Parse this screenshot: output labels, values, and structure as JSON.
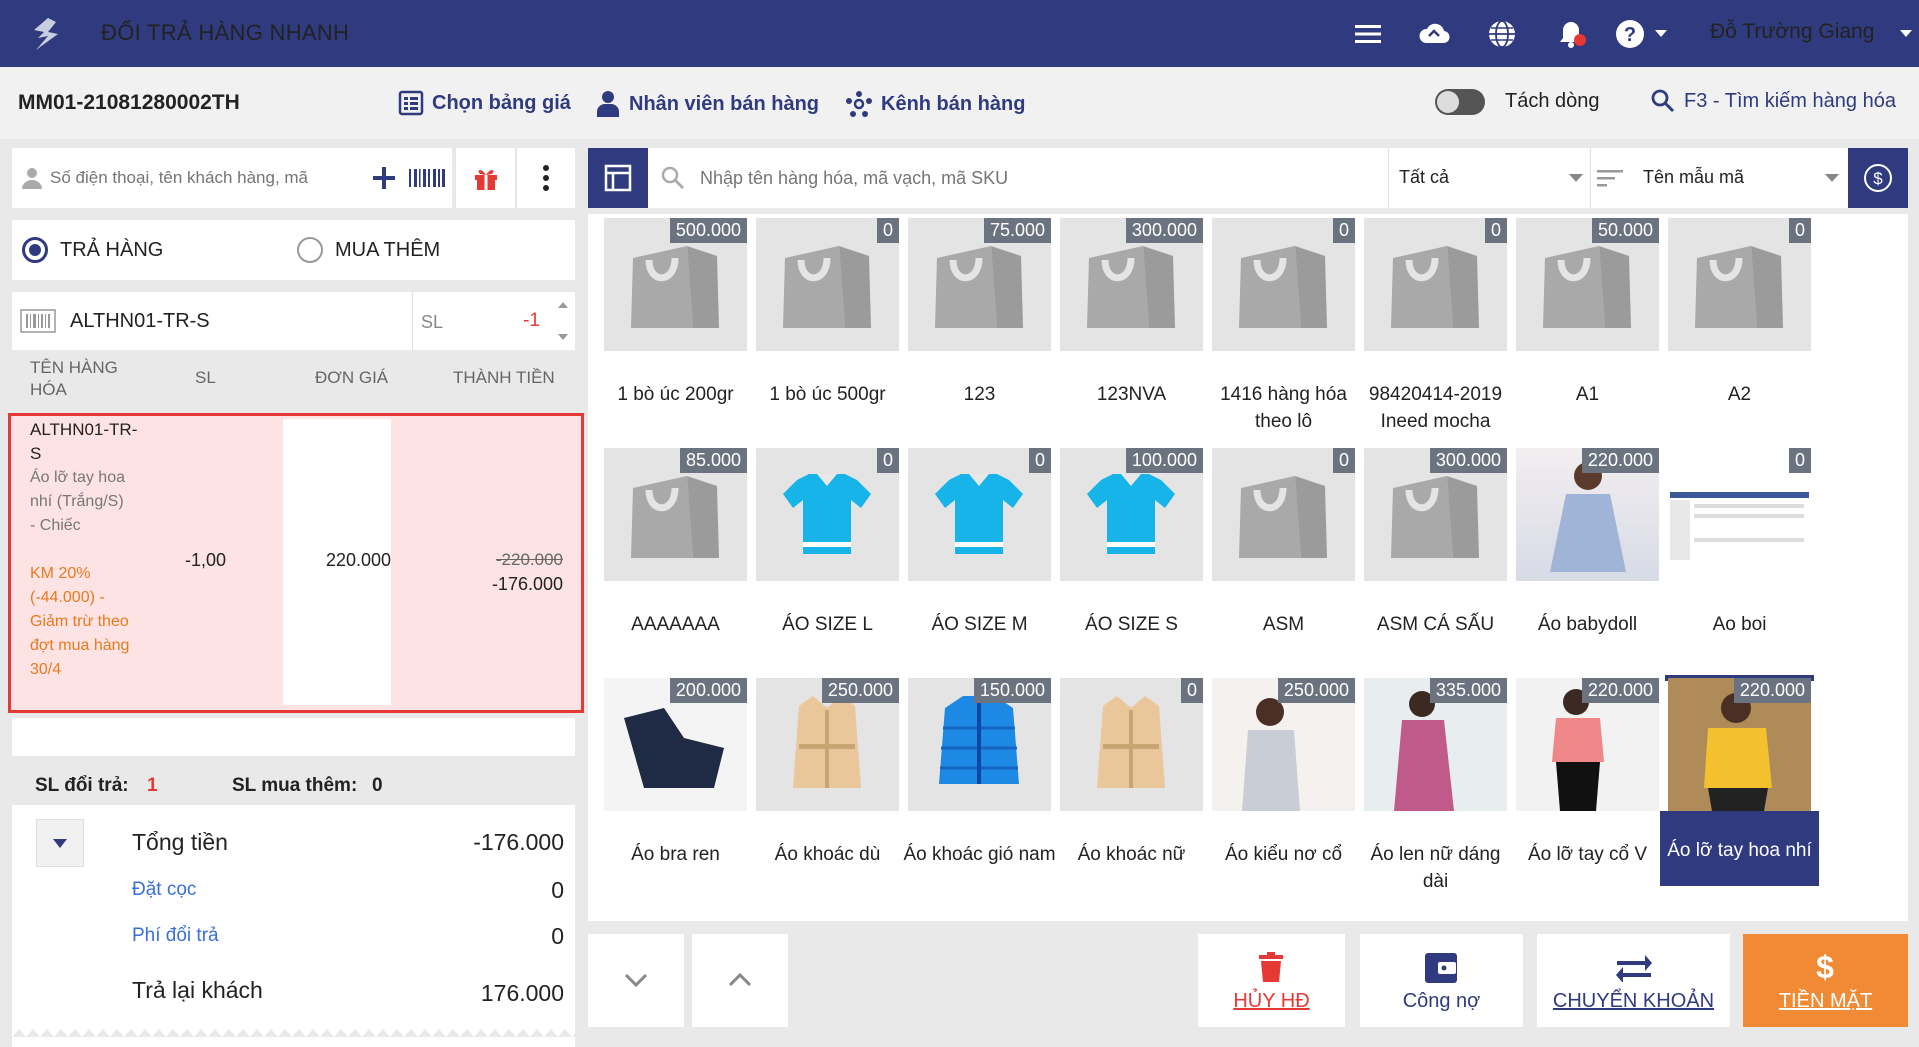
{
  "header": {
    "app_title": "ĐỔI TRẢ HÀNG NHANH",
    "user_name": "Đỗ Trường Giang",
    "icons": [
      "menu-icon",
      "cloud-sync-icon",
      "globe-icon",
      "bell-icon",
      "help-icon"
    ]
  },
  "toolbar": {
    "order_code": "MM01-21081280002TH",
    "price_list": "Chọn bảng giá",
    "sales_staff": "Nhân viên bán hàng",
    "sales_channel": "Kênh bán hàng",
    "split_line": "Tách dòng",
    "search_goods": "F3 - Tìm kiếm hàng hóa"
  },
  "customer": {
    "placeholder": "Số điện thoại, tên khách hàng, mã"
  },
  "mode": {
    "return_label": "TRẢ HÀNG",
    "buy_more_label": "MUA THÊM"
  },
  "scan": {
    "code": "ALTHN01-TR-S",
    "qty_label": "SL",
    "qty_value": "-1"
  },
  "table": {
    "col_name": "TÊN HÀNG HÓA",
    "col_qty": "SL",
    "col_price": "ĐƠN GIÁ",
    "col_total": "THÀNH TIỀN"
  },
  "item": {
    "code": "ALTHN01-TR-S",
    "desc": "Áo lỡ tay hoa nhí (Trắng/S) - Chiếc",
    "promo": "KM 20% (-44.000) - Giảm trừ theo đợt mua hàng 30/4",
    "qty": "-1,00",
    "unit_price": "220.000",
    "old_total": "-220.000",
    "total": "-176.000"
  },
  "summary": {
    "return_qty_label": "SL đổi trả:",
    "return_qty": "1",
    "buy_more_label": "SL mua thêm:",
    "buy_more": "0"
  },
  "totals": {
    "total_label": "Tổng tiền",
    "total_value": "-176.000",
    "deposit_label": "Đặt cọc",
    "deposit_value": "0",
    "fee_label": "Phí đổi trả",
    "fee_value": "0",
    "refund_label": "Trả lại khách",
    "refund_value": "176.000"
  },
  "search": {
    "placeholder": "Nhập tên hàng hóa, mã vạch, mã SKU",
    "filter_all": "Tất cả",
    "sort_label": "Tên mẫu mã"
  },
  "products": [
    {
      "name": "1 bò úc 200gr",
      "price": "500.000",
      "img": "bag"
    },
    {
      "name": "1 bò úc 500gr",
      "price": "0",
      "img": "bag"
    },
    {
      "name": "123",
      "price": "75.000",
      "img": "bag"
    },
    {
      "name": "123NVA",
      "price": "300.000",
      "img": "bag"
    },
    {
      "name": "1416 hàng hóa theo lô",
      "price": "0",
      "img": "bag"
    },
    {
      "name": "98420414-2019 Ineed mocha",
      "price": "0",
      "img": "bag"
    },
    {
      "name": "A1",
      "price": "50.000",
      "img": "bag"
    },
    {
      "name": "A2",
      "price": "0",
      "img": "bag"
    },
    {
      "name": "AAAAAAA",
      "price": "85.000",
      "img": "bag"
    },
    {
      "name": "ÁO SIZE L",
      "price": "0",
      "img": "shirt"
    },
    {
      "name": "ÁO SIZE M",
      "price": "0",
      "img": "shirt"
    },
    {
      "name": "ÁO SIZE S",
      "price": "100.000",
      "img": "shirt"
    },
    {
      "name": "ASM",
      "price": "0",
      "img": "bag"
    },
    {
      "name": "ASM CÁ SẤU",
      "price": "300.000",
      "img": "bag"
    },
    {
      "name": "Áo babydoll",
      "price": "220.000",
      "img": "photo-blue"
    },
    {
      "name": "Ao boi",
      "price": "0",
      "img": "photo-screen"
    },
    {
      "name": "Áo bra ren",
      "price": "200.000",
      "img": "photo-navy"
    },
    {
      "name": "Áo khoác dù",
      "price": "250.000",
      "img": "coat"
    },
    {
      "name": "Áo khoác gió nam",
      "price": "150.000",
      "img": "jacket"
    },
    {
      "name": "Áo khoác nữ",
      "price": "0",
      "img": "coat"
    },
    {
      "name": "Áo kiểu nơ cổ",
      "price": "250.000",
      "img": "photo-grey"
    },
    {
      "name": "Áo len nữ dáng dài",
      "price": "335.000",
      "img": "photo-pink"
    },
    {
      "name": "Áo lỡ tay cổ V",
      "price": "220.000",
      "img": "photo-salmon"
    },
    {
      "name": "Áo lỡ tay hoa nhí",
      "price": "220.000",
      "img": "photo-yellow",
      "selected": true
    }
  ],
  "actions": {
    "cancel": "HỦY HĐ",
    "debt": "Công nợ",
    "transfer": "CHUYỂN KHOẢN",
    "cash": "TIỀN MẶT",
    "cancel_color": "#e53935",
    "cash_bg": "#f08a35"
  }
}
